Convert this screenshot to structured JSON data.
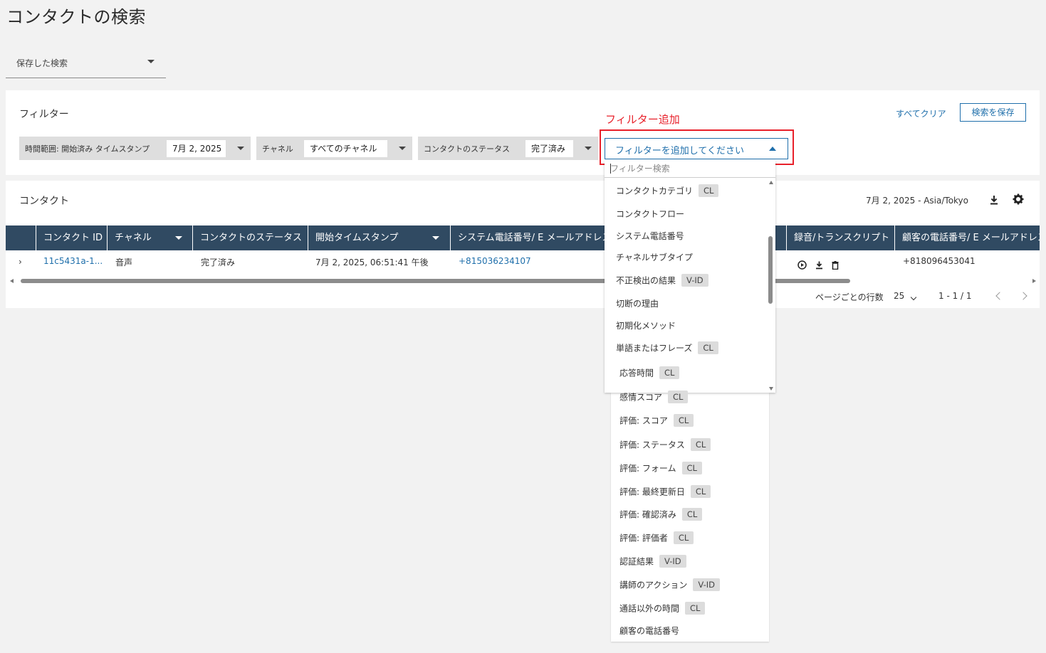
{
  "page": {
    "title": "コンタクトの検索"
  },
  "saved_search": {
    "label": "保存した検索"
  },
  "filters": {
    "title": "フィルター",
    "clear_all": "すべてクリア",
    "save_search": "検索を保存",
    "chips": [
      {
        "label": "時間範囲: 開始済み タイムスタンプ",
        "value": "7月 2, 2025"
      },
      {
        "label": "チャネル",
        "value": "すべてのチャネル"
      },
      {
        "label": "コンタクトのステータス",
        "value": "完了済み"
      }
    ],
    "annotation": "フィルター追加",
    "add_filter_label": "フィルターを追加してください",
    "search_placeholder": "フィルター検索"
  },
  "dropdown_options": [
    {
      "label": "コンタクトカテゴリ",
      "badge": "CL"
    },
    {
      "label": "コンタクトフロー",
      "badge": ""
    },
    {
      "label": "システム電話番号",
      "badge": ""
    },
    {
      "label": "チャネルサブタイプ",
      "badge": ""
    },
    {
      "label": "不正検出の結果",
      "badge": "V-ID"
    },
    {
      "label": "切断の理由",
      "badge": ""
    },
    {
      "label": "初期化メソッド",
      "badge": ""
    },
    {
      "label": "単語またはフレーズ",
      "badge": "CL"
    },
    {
      "label": "応答時間",
      "badge": "CL"
    },
    {
      "label": "感情スコア",
      "badge": "CL"
    },
    {
      "label": "評価: スコア",
      "badge": "CL"
    },
    {
      "label": "評価: ステータス",
      "badge": "CL"
    },
    {
      "label": "評価: フォーム",
      "badge": "CL"
    },
    {
      "label": "評価: 最終更新日",
      "badge": "CL"
    },
    {
      "label": "評価: 確認済み",
      "badge": "CL"
    },
    {
      "label": "評価: 評価者",
      "badge": "CL"
    },
    {
      "label": "認証結果",
      "badge": "V-ID"
    },
    {
      "label": "講師のアクション",
      "badge": "V-ID"
    },
    {
      "label": "通話以外の時間",
      "badge": "CL"
    },
    {
      "label": "顧客の電話番号",
      "badge": ""
    }
  ],
  "contacts": {
    "title": "コンタクト",
    "date_tz": "7月 2, 2025 - Asia/Tokyo",
    "columns": {
      "contact_id": "コンタクト ID",
      "channel": "チャネル",
      "status": "コンタクトのステータス",
      "start": "開始タイムスタンプ",
      "system_phone": "システム電話番号/ E メールアドレス",
      "recording": "録音/トランスクリプト",
      "customer_phone": "顧客の電話番号/ E メールアドレス"
    },
    "row": {
      "contact_id": "11c5431a-1...",
      "channel": "音声",
      "status": "完了済み",
      "start": "7月 2, 2025, 06:51:41 午後",
      "system_phone": "+815036234107",
      "customer_phone": "+818096453041"
    },
    "pager": {
      "rows_label": "ページごとの行数",
      "rows_value": "25",
      "range": "1 - 1 / 1"
    }
  },
  "colors": {
    "accent": "#1f6fab",
    "header_bg": "#304a62",
    "annotation": "#e8202a"
  }
}
